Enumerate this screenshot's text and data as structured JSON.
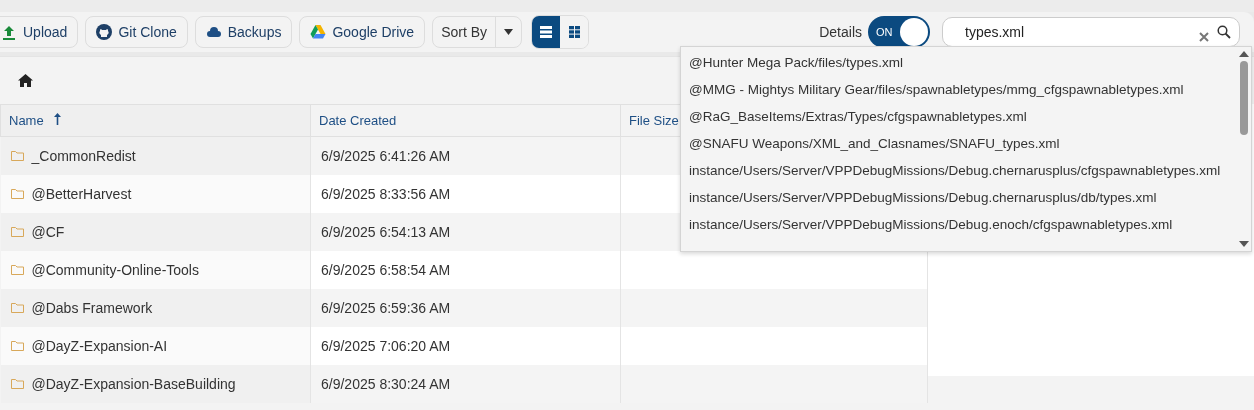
{
  "toolbar": {
    "buttons": [
      {
        "label": "Upload",
        "kind": "upload"
      },
      {
        "label": "Git Clone",
        "kind": "git"
      },
      {
        "label": "Backups",
        "kind": "cloud"
      },
      {
        "label": "Google Drive",
        "kind": "drive"
      }
    ],
    "sort": {
      "label": "Sort By"
    },
    "views": [
      {
        "kind": "list",
        "selected": true
      },
      {
        "kind": "grid",
        "selected": false
      }
    ],
    "details": {
      "label": "Details",
      "toggle": "ON",
      "on": true
    },
    "search": {
      "value": "types.xml"
    }
  },
  "suggestions": [
    "@Hunter Mega Pack/files/types.xml",
    "@MMG - Mightys Military Gear/files/spawnabletypes/mmg_cfgspawnabletypes.xml",
    "@RaG_BaseItems/Extras/Types/cfgspawnabletypes.xml",
    "@SNAFU Weapons/XML_and_Clasnames/SNAFU_types.xml",
    "instance/Users/Server/VPPDebugMissions/Debug.chernarusplus/cfgspawnabletypes.xml",
    "instance/Users/Server/VPPDebugMissions/Debug.chernarusplus/db/types.xml",
    "instance/Users/Server/VPPDebugMissions/Debug.enoch/cfgspawnabletypes.xml"
  ],
  "table": {
    "columns": [
      {
        "label": "Name",
        "sorted": true
      },
      {
        "label": "Date Created",
        "sorted": false
      },
      {
        "label": "File Size",
        "sorted": false
      }
    ],
    "rows": [
      {
        "name": "_CommonRedist",
        "date": "6/9/2025 6:41:26 AM"
      },
      {
        "name": "@BetterHarvest",
        "date": "6/9/2025 8:33:56 AM"
      },
      {
        "name": "@CF",
        "date": "6/9/2025 6:54:13 AM"
      },
      {
        "name": "@Community-Online-Tools",
        "date": "6/9/2025 6:58:54 AM"
      },
      {
        "name": "@Dabs Framework",
        "date": "6/9/2025 6:59:36 AM"
      },
      {
        "name": "@DayZ-Expansion-AI",
        "date": "6/9/2025 7:06:20 AM"
      },
      {
        "name": "@DayZ-Expansion-BaseBuilding",
        "date": "6/9/2025 8:30:24 AM"
      }
    ]
  }
}
